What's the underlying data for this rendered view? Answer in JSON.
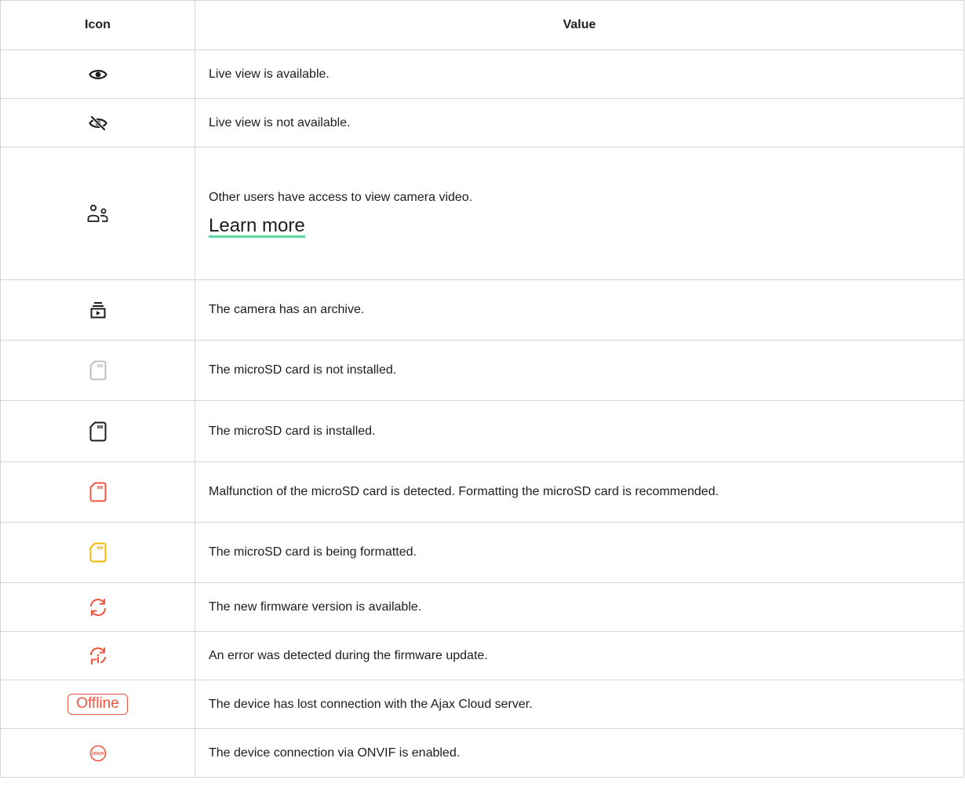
{
  "table": {
    "headers": {
      "icon": "Icon",
      "value": "Value"
    },
    "rows": [
      {
        "icon": "eye-icon",
        "value": "Live view is available."
      },
      {
        "icon": "eye-off-icon",
        "value": "Live view is not available."
      },
      {
        "icon": "users-shared-icon",
        "value": "Other users have access to view camera video.",
        "link": "Learn more"
      },
      {
        "icon": "archive-icon",
        "value": "The camera has an archive."
      },
      {
        "icon": "microsd-not-installed-icon",
        "value": "The microSD card is not installed."
      },
      {
        "icon": "microsd-installed-icon",
        "value": "The microSD card is installed."
      },
      {
        "icon": "microsd-malfunction-icon",
        "value": "Malfunction of the microSD card is detected. Formatting the microSD card is recommended."
      },
      {
        "icon": "microsd-formatting-icon",
        "value": "The microSD card is being formatted."
      },
      {
        "icon": "firmware-update-icon",
        "value": "The new firmware version is available."
      },
      {
        "icon": "firmware-error-icon",
        "value": "An error was detected during the firmware update."
      },
      {
        "icon": "offline-badge",
        "badge": "Offline",
        "value": "The device has lost connection with the Ajax Cloud server."
      },
      {
        "icon": "onvif-icon",
        "badge": "ONVIF",
        "value": "The device connection via ONVIF is enabled."
      }
    ]
  },
  "colors": {
    "text": "#1d1d1d",
    "border": "#d4d4d4",
    "red": "#f0543e",
    "yellow": "#f2b705",
    "grey": "#b8b8b8",
    "link_underline": "#5fd6a4"
  }
}
